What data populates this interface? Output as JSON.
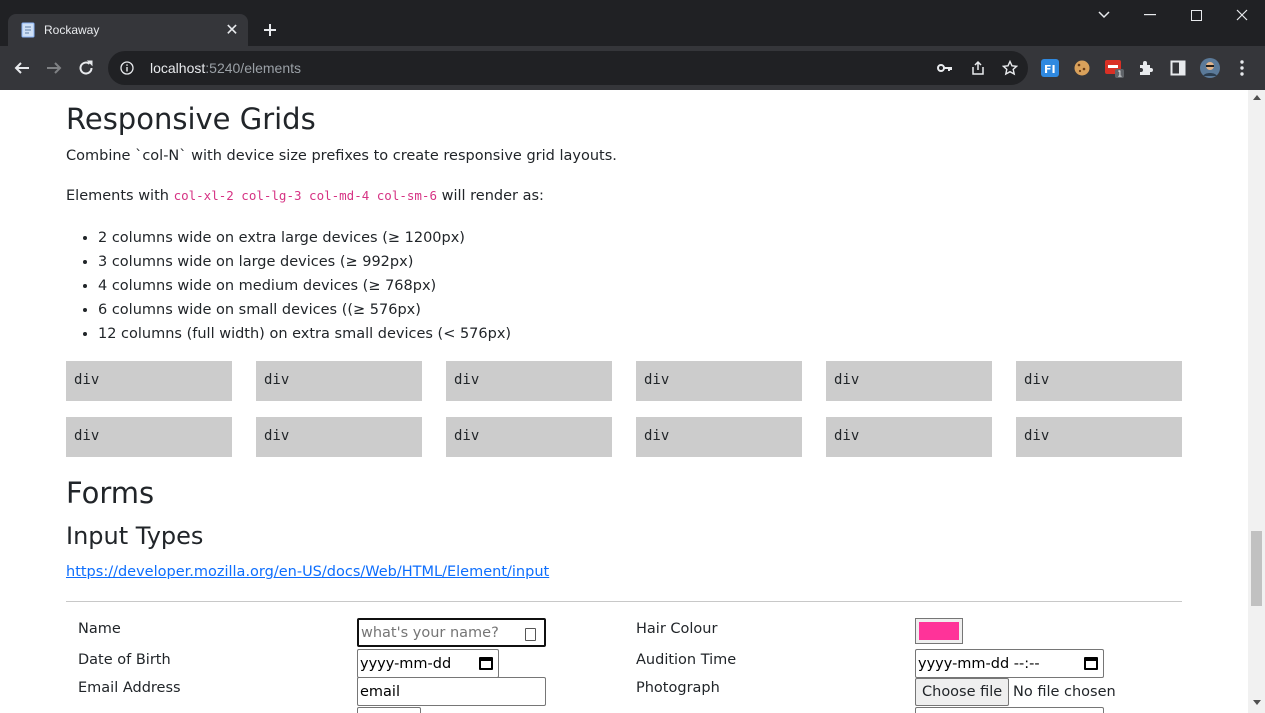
{
  "browser": {
    "tab_title": "Rockaway",
    "url_host": "localhost",
    "url_rest": ":5240/elements",
    "extension_badge": "1"
  },
  "page": {
    "responsive": {
      "heading": "Responsive Grids",
      "intro": "Combine `col-N` with device size prefixes to create responsive grid layouts.",
      "elements_prefix": "Elements with ",
      "elements_code": "col-xl-2 col-lg-3 col-md-4 col-sm-6",
      "elements_suffix": " will render as:",
      "bullets": [
        "2 columns wide on extra large devices (≥ 1200px)",
        "3 columns wide on large devices (≥ 992px)",
        "4 columns wide on medium devices (≥ 768px)",
        "6 columns wide on small devices ((≥ 576px)",
        "12 columns (full width) on extra small devices (< 576px)"
      ],
      "grid_rows": [
        [
          "div",
          "div",
          "div",
          "div",
          "div",
          "div"
        ],
        [
          "div",
          "div",
          "div",
          "div",
          "div",
          "div"
        ]
      ]
    },
    "forms": {
      "heading": "Forms",
      "subheading": "Input Types",
      "link": "https://developer.mozilla.org/en-US/docs/Web/HTML/Element/input",
      "fields": {
        "name_label": "Name",
        "name_placeholder": "what's your name?",
        "dob_label": "Date of Birth",
        "dob_value": "yyyy-mm-dd",
        "email_label": "Email Address",
        "email_value": "email",
        "hair_label": "Hair Colour",
        "hair_color": "#ff3399",
        "audition_label": "Audition Time",
        "audition_value": "yyyy-mm-dd --:--",
        "photo_label": "Photograph",
        "photo_button": "Choose file",
        "photo_status": "No file chosen"
      }
    }
  }
}
